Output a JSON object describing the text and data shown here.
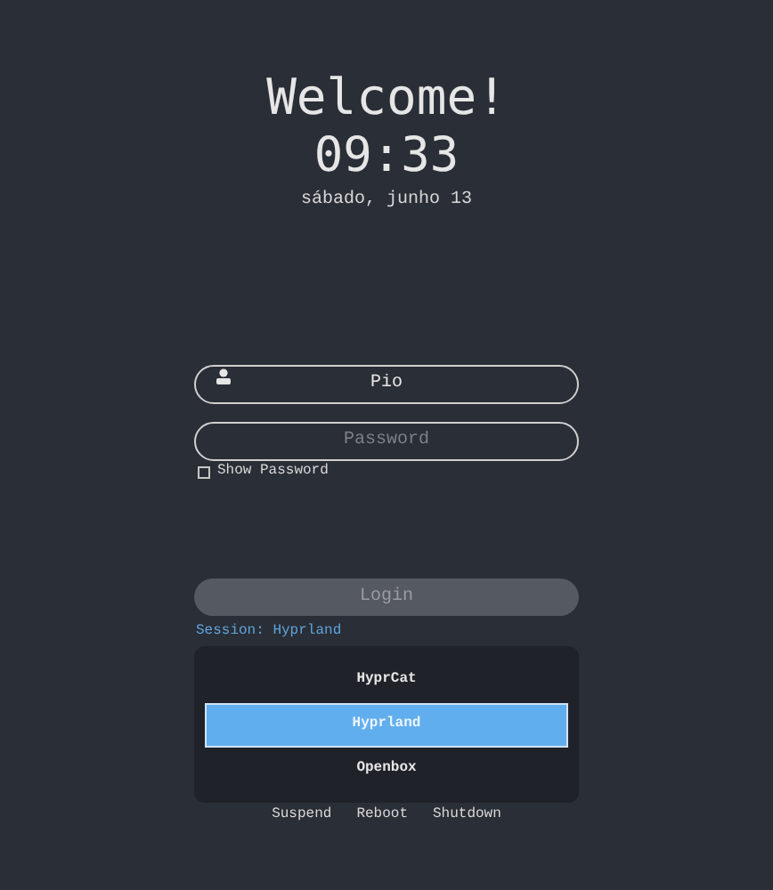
{
  "greeting": "Welcome!",
  "time": "09:33",
  "date": "sábado, junho 13",
  "username": {
    "value": "Pio"
  },
  "password": {
    "placeholder": "Password"
  },
  "show_password": {
    "label": "Show Password",
    "checked": false
  },
  "login_button": {
    "label": "Login",
    "disabled": true
  },
  "session_label": "Session: Hyprland",
  "sessions": [
    {
      "label": "HyprCat",
      "selected": false
    },
    {
      "label": "Hyprland",
      "selected": true
    },
    {
      "label": "Openbox",
      "selected": false
    }
  ],
  "power_actions": [
    "Suspend",
    "Reboot",
    "Shutdown"
  ]
}
